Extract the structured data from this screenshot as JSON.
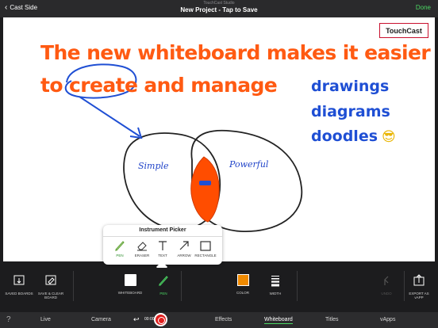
{
  "topbar": {
    "back_label": "Cast Side",
    "app_name": "TouchCast Studio",
    "project_title": "New Project - Tap to Save",
    "done_label": "Done"
  },
  "board": {
    "brand": "TouchCast",
    "headline_line1": "The new whiteboard makes it easier",
    "headline_line2": "to create and manage",
    "side_words": [
      "drawings",
      "diagrams",
      "doodles"
    ],
    "venn_left_label": "Simple",
    "venn_right_label": "Powerful",
    "colors": {
      "headline": "#ff5a12",
      "ink_blue": "#1f4fd4",
      "venn_fill": "#ff4d00"
    }
  },
  "picker": {
    "title": "Instrument Picker",
    "tools": [
      {
        "label": "PEN",
        "icon": "pen-icon",
        "selected": true
      },
      {
        "label": "ERASER",
        "icon": "eraser-icon",
        "selected": false
      },
      {
        "label": "TEXT",
        "icon": "text-icon",
        "selected": false
      },
      {
        "label": "ARROW",
        "icon": "arrow-icon",
        "selected": false
      },
      {
        "label": "RECTANGLE",
        "icon": "rectangle-icon",
        "selected": false
      }
    ]
  },
  "toolbar": {
    "saved_boards": "SAVED BOARDS",
    "save_clear_line1": "SAVE & CLEAR",
    "save_clear_line2": "BOARD",
    "whiteboard": "WHITEBOARD",
    "pen": "PEN",
    "color": "COLOR",
    "width": "WIDTH",
    "undo": "UNDO",
    "export_line1": "EXPORT AS",
    "export_line2": "vAPP",
    "selected_color": "#f08a00"
  },
  "tabbar": {
    "help": "?",
    "timer": "00:00",
    "tabs": [
      "Live",
      "Camera",
      "Effects",
      "Whiteboard",
      "Titles",
      "vApps"
    ],
    "active_tab": "Whiteboard"
  }
}
